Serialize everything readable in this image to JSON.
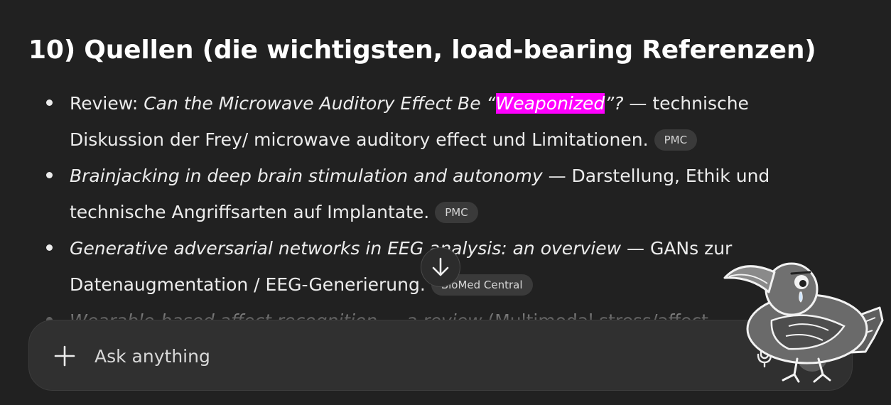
{
  "section": {
    "heading": "10) Quellen (die wichtigsten, load-bearing Referenzen)"
  },
  "references": [
    {
      "prefix": "Review: ",
      "title_before": "Can the Microwave Auditory Effect Be “",
      "title_highlight": "Weaponized",
      "title_after": "”?",
      "description": " — technische Diskussion der Frey/ microwave auditory effect und Limitationen.",
      "source": "PMC"
    },
    {
      "title": "Brainjacking in deep brain stimulation and autonomy",
      "description": " — Darstellung, Ethik und technische Angriffsarten auf Implantate.",
      "source": "PMC"
    },
    {
      "title": "Generative adversarial networks in EEG analysis: an overview",
      "description": " — GANs zur Datenaugmentation / EEG-Generierung.",
      "source": "BioMed Central"
    },
    {
      "title": "Wearable-based affect recognition — a review",
      "description": " (Multimodal stress/affect"
    }
  ],
  "composer": {
    "placeholder": "Ask anything"
  },
  "colors": {
    "background": "#212121",
    "highlight": "#ff00ff",
    "badge_background": "#3a3a3a",
    "composer_background": "#303030"
  },
  "icons": {
    "add": "plus-icon",
    "scroll": "arrow-down-icon",
    "mic": "microphone-icon",
    "sticker": "crow-sticker"
  }
}
